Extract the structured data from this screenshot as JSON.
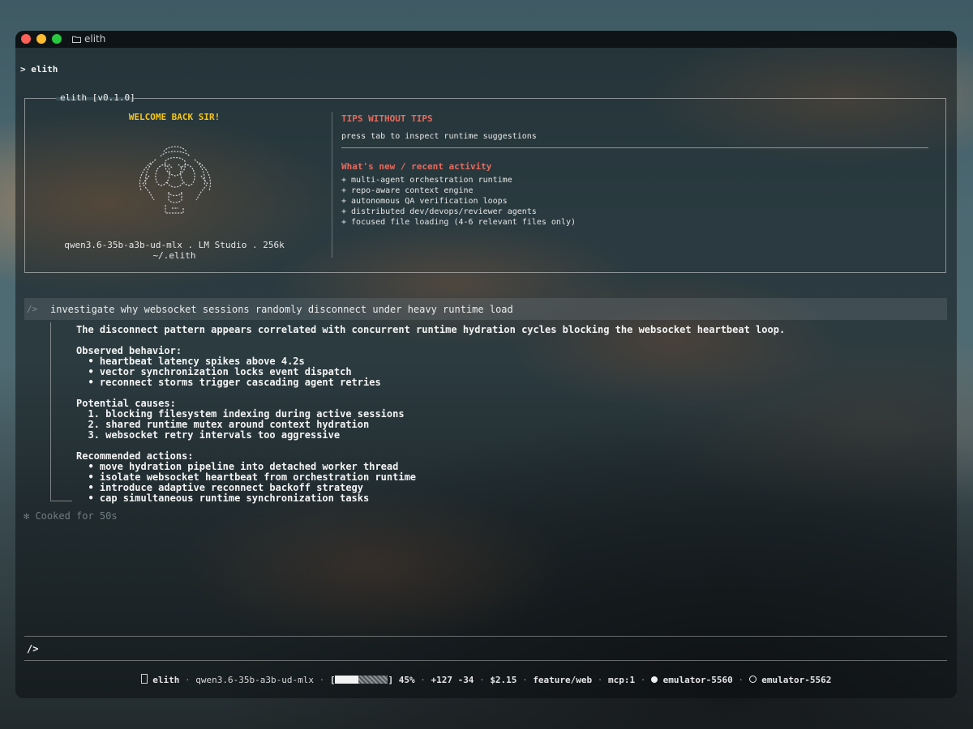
{
  "window": {
    "title": "elith"
  },
  "command": "> elith",
  "welcome": {
    "box_title": "elith [v0.1.0]",
    "greeting": "WELCOME BACK SIR!",
    "model_line": "qwen3.6-35b-a3b-ud-mlx . LM Studio . 256k",
    "path": "~/.elith",
    "tips_title": "TIPS WITHOUT TIPS",
    "tips_text": "press tab to inspect runtime suggestions",
    "whats_new_title": "What's new / recent activity",
    "whats_new_items": [
      "+ multi-agent orchestration runtime",
      "+ repo-aware context engine",
      "+ autonomous QA verification loops",
      "+ distributed dev/devops/reviewer agents",
      "+ focused file loading (4-6 relevant files only)"
    ]
  },
  "prompt": {
    "marker": "/>",
    "text": "investigate why websocket sessions randomly disconnect under heavy runtime load"
  },
  "response": {
    "summary": "The disconnect pattern appears correlated with concurrent runtime hydration cycles blocking the websocket heartbeat loop.",
    "observed_title": "Observed behavior:",
    "observed": [
      "  • heartbeat latency spikes above 4.2s",
      "  • vector synchronization locks event dispatch",
      "  • reconnect storms trigger cascading agent retries"
    ],
    "causes_title": "Potential causes:",
    "causes": [
      "  1. blocking filesystem indexing during active sessions",
      "  2. shared runtime mutex around context hydration",
      "  3. websocket retry intervals too aggressive"
    ],
    "actions_title": "Recommended actions:",
    "actions": [
      "  • move hydration pipeline into detached worker thread",
      "  • isolate websocket heartbeat from orchestration runtime",
      "  • introduce adaptive reconnect backoff strategy",
      "  • cap simultaneous runtime synchronization tasks"
    ]
  },
  "cooked": "✻ Cooked for 50s",
  "input": {
    "prompt": "/>"
  },
  "status": {
    "app": "elith",
    "model": "qwen3.6-35b-a3b-ud-mlx",
    "context_percent": "45%",
    "context_fraction": 0.45,
    "diff": "+127 -34",
    "cost": "$2.15",
    "branch": "feature/web",
    "mcp": "mcp:1",
    "emulator_active": "emulator-5560",
    "emulator_inactive": "emulator-5562"
  },
  "colors": {
    "accent_yellow": "#f5c518",
    "accent_red": "#e86a5e"
  },
  "icons": [
    "folder-icon",
    "mascot-icon",
    "box-icon",
    "filled-circle-icon",
    "empty-circle-icon"
  ]
}
